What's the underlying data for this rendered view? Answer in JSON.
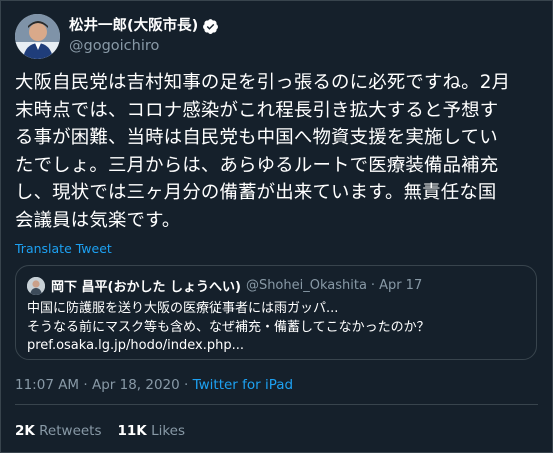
{
  "author": {
    "display_name": "松井一郎(大阪市長)",
    "handle": "@gogoichiro",
    "verified": true,
    "avatar_icon": "profile-photo-icon",
    "verified_icon": "verified-badge-icon"
  },
  "tweet": {
    "lines": [
      "大阪自民党は吉村知事の足を引っ張るのに必死ですね。2月",
      "末時点では、コロナ感染がこれ程長引き拡大すると予想す",
      "る事が困難、当時は自民党も中国へ物資支援を実施してい",
      "たでしょ。三月からは、あらゆるルートで医療装備品補充",
      "し、現状では三ヶ月分の備蓄が出来ています。無責任な国",
      "会議員は気楽です。"
    ],
    "translate_label": "Translate Tweet"
  },
  "quoted_tweet": {
    "display_name": "岡下 昌平(おかした しょうへい)",
    "handle": "@Shohei_Okashita",
    "separator": "·",
    "date": "Apr 17",
    "lines": [
      "中国に防護服を送り大阪の医療従事者には雨ガッパ...",
      "そうなる前にマスク等も含め、なぜ補充・備蓄してこなかったのか？",
      "pref.osaka.lg.jp/hodo/index.php..."
    ]
  },
  "meta": {
    "timestamp": "11:07 AM · Apr 18, 2020",
    "separator": "·",
    "source": "Twitter for iPad"
  },
  "stats": {
    "retweets_count": "2K",
    "retweets_label": "Retweets",
    "likes_count": "11K",
    "likes_label": "Likes"
  },
  "colors": {
    "background": "#15202b",
    "accent": "#1da1f2",
    "secondary_text": "#8899a6",
    "border": "#38444d"
  }
}
